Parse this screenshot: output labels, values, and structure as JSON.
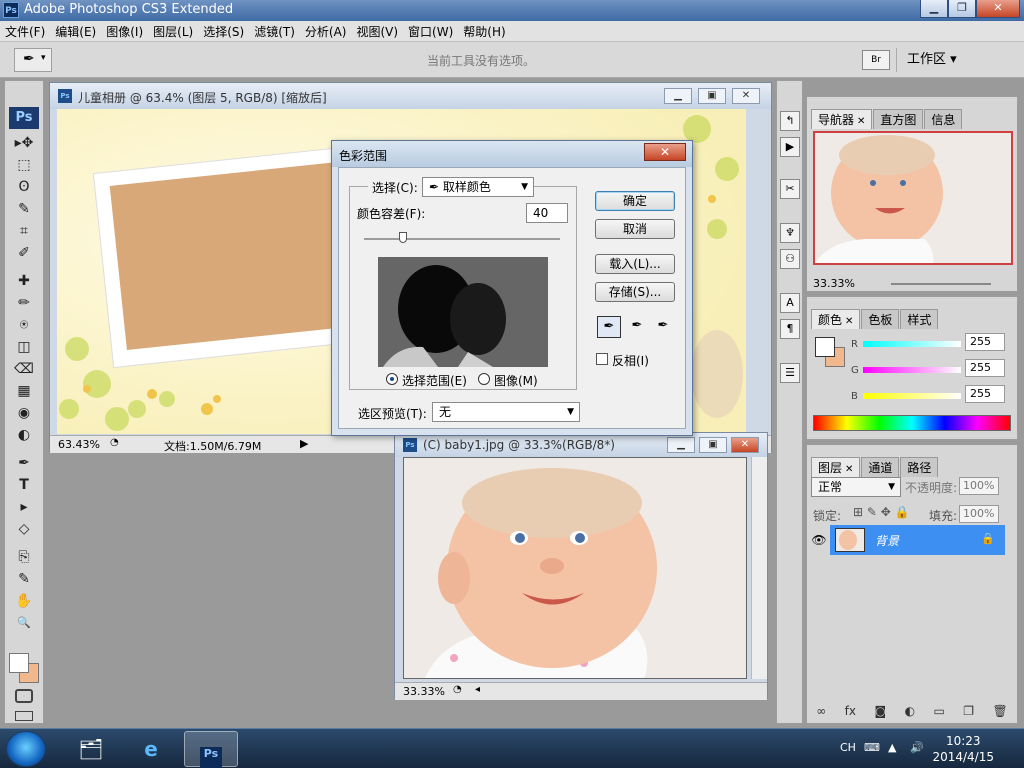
{
  "app": {
    "title": "Adobe Photoshop CS3 Extended",
    "icon_label": "Ps"
  },
  "window_controls": {
    "minimize": "▁",
    "restore": "❐",
    "close": "✕"
  },
  "menu": [
    "文件(F)",
    "编辑(E)",
    "图像(I)",
    "图层(L)",
    "选择(S)",
    "滤镜(T)",
    "分析(A)",
    "视图(V)",
    "窗口(W)",
    "帮助(H)"
  ],
  "options_bar": {
    "hint": "当前工具没有选项。",
    "br_label": "Br",
    "workspace": "工作区 ▾"
  },
  "toolbox": {
    "logo": "Ps",
    "tools": [
      "▸✥",
      "⬚",
      "ʘ",
      "✎",
      "⌗",
      "✐",
      "✚",
      "✏",
      "⍟",
      "◫",
      "⌫",
      "▦",
      "◉",
      "◐",
      "✒",
      "T",
      "▸",
      "◇",
      "⎘",
      "✎",
      "✋",
      "🔍"
    ]
  },
  "doc1": {
    "title": "儿童相册 @ 63.4% (图层 5, RGB/8) [缩放后]",
    "zoom": "63.43%",
    "doc_info": "文档:1.50M/6.79M"
  },
  "doc2": {
    "title": "(C) baby1.jpg @ 33.3%(RGB/8*)",
    "zoom": "33.33%"
  },
  "dialog": {
    "title": "色彩范围",
    "select_label": "选择(C):",
    "select_value": "取样颜色",
    "fuzziness_label": "颜色容差(F):",
    "fuzziness_value": "40",
    "radio_selection": "选择范围(E)",
    "radio_image": "图像(M)",
    "preview_label": "选区预览(T):",
    "preview_value": "无",
    "ok": "确定",
    "cancel": "取消",
    "load": "载入(L)...",
    "save": "存储(S)...",
    "invert": "反相(I)",
    "fuzziness_slider_fraction": 0.2
  },
  "navigator": {
    "tabs": [
      "导航器",
      "直方图",
      "信息"
    ],
    "zoom": "33.33%"
  },
  "color_panel": {
    "tabs": [
      "颜色",
      "色板",
      "样式"
    ],
    "r_label": "R",
    "g_label": "G",
    "b_label": "B",
    "r": "255",
    "g": "255",
    "b": "255"
  },
  "layers_panel": {
    "tabs": [
      "图层",
      "通道",
      "路径"
    ],
    "blend": "正常",
    "opacity_label": "不透明度:",
    "opacity": "100%",
    "lock_label": "锁定:",
    "fill_label": "填充:",
    "fill": "100%",
    "layer_name": "背景"
  },
  "taskbar": {
    "ime": "CH",
    "time": "10:23",
    "date": "2014/4/15"
  }
}
